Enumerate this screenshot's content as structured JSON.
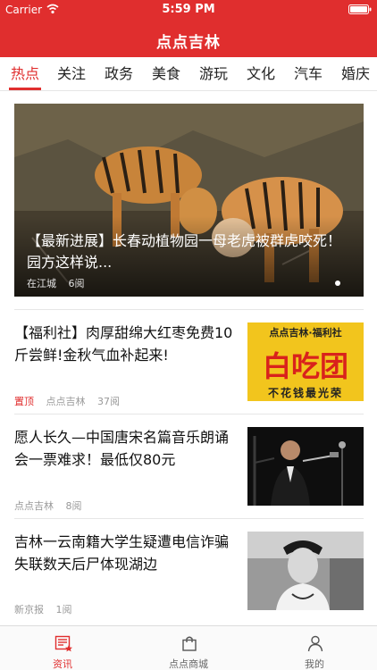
{
  "status_bar": {
    "carrier": "Carrier",
    "time": "5:59 PM"
  },
  "header": {
    "title": "点点吉林"
  },
  "tabs": [
    {
      "label": "热点",
      "active": true
    },
    {
      "label": "关注"
    },
    {
      "label": "政务"
    },
    {
      "label": "美食"
    },
    {
      "label": "游玩"
    },
    {
      "label": "文化"
    },
    {
      "label": "汽车"
    },
    {
      "label": "婚庆"
    }
  ],
  "hero": {
    "title": "【最新进展】长春动植物园一母老虎被群虎咬死！园方这样说...",
    "source": "在江城",
    "reads": "6阅"
  },
  "articles": [
    {
      "title": "【福利社】肉厚甜绵大红枣免费10斤尝鲜!金秋气血补起来!",
      "badge": "置顶",
      "source": "点点吉林",
      "reads": "37阅",
      "thumb_title": "点点吉林·福利社",
      "thumb_main": "白吃团",
      "thumb_sub": "不花钱最光荣"
    },
    {
      "title": "愿人长久—中国唐宋名篇音乐朗诵会一票难求！最低仅80元",
      "source": "点点吉林",
      "reads": "8阅"
    },
    {
      "title": "吉林一云南籍大学生疑遭电信诈骗 失联数天后尸体现湖边",
      "source": "新京报",
      "reads": "1阅"
    }
  ],
  "tabbar": [
    {
      "label": "资讯",
      "icon": "news-icon",
      "active": true
    },
    {
      "label": "点点商城",
      "icon": "shopping-bag-icon"
    },
    {
      "label": "我的",
      "icon": "person-icon"
    }
  ],
  "colors": {
    "brand": "#e02e2e",
    "thumb_yellow": "#f2c51d"
  }
}
